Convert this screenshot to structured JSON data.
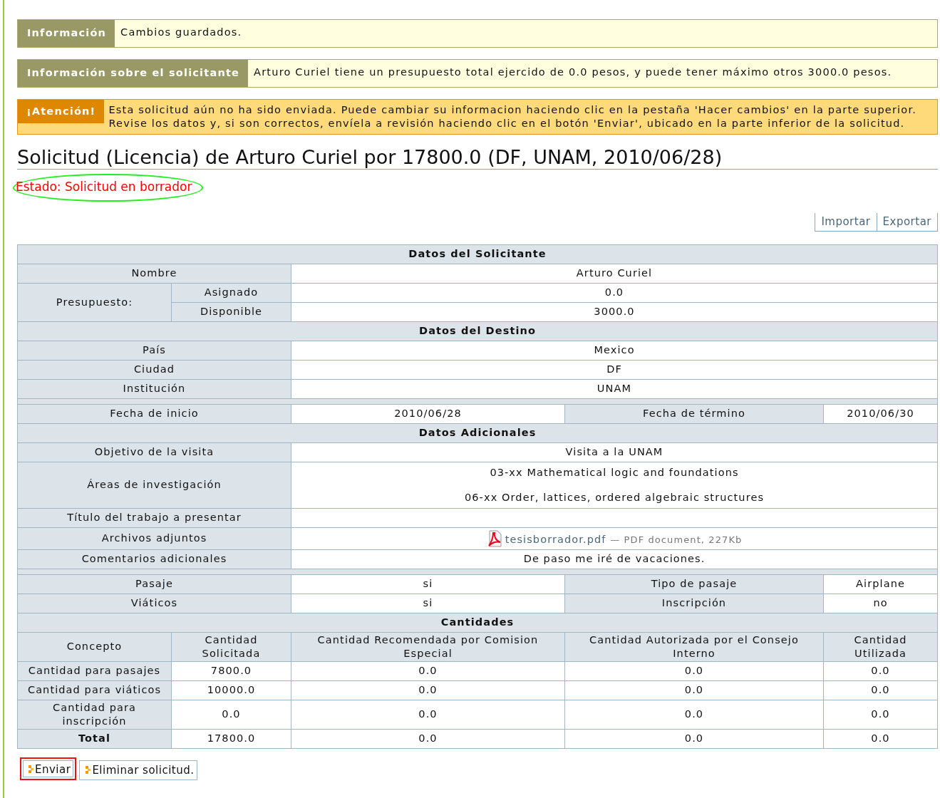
{
  "messages": [
    {
      "kind": "info",
      "label": "Información",
      "lines": [
        "Cambios guardados."
      ]
    },
    {
      "kind": "info",
      "label": "Información sobre el solicitante",
      "lines": [
        "Arturo Curiel tiene un presupuesto total ejercido de 0.0 pesos, y puede tener máximo otros 3000.0 pesos."
      ]
    },
    {
      "kind": "warning",
      "label": "¡Atención!",
      "lines": [
        "Esta solicitud aún no ha sido enviada. Puede cambiar su informacion haciendo clic en la pestaña 'Hacer cambios' en la parte superior.",
        "Revise los datos y, si son correctos, envíela a revisión haciendo clic en el botón 'Enviar', ubicado en la parte inferior de la solicitud."
      ]
    }
  ],
  "title": "Solicitud (Licencia) de Arturo Curiel por 17800.0 (DF, UNAM, 2010/06/28)",
  "status": {
    "text": "Estado: Solicitud en borrador",
    "highlighted": true
  },
  "actions": [
    "Importar",
    "Exportar"
  ],
  "applicant": {
    "heading": "Datos del Solicitante",
    "name_label": "Nombre",
    "name": "Arturo Curiel",
    "budget_label": "Presupuesto:",
    "budget": [
      {
        "label": "Asignado",
        "value": "0.0"
      },
      {
        "label": "Disponible",
        "value": "3000.0"
      }
    ]
  },
  "destination": {
    "heading": "Datos del Destino",
    "rows": [
      {
        "label": "País",
        "value": "Mexico"
      },
      {
        "label": "Ciudad",
        "value": "DF"
      },
      {
        "label": "Institución",
        "value": "UNAM"
      }
    ]
  },
  "dates": [
    {
      "label": "Fecha de inicio",
      "value": "2010/06/28"
    },
    {
      "label": "Fecha de término",
      "value": "2010/06/30"
    }
  ],
  "additional": {
    "heading": "Datos Adicionales",
    "rows": [
      {
        "kind": "text",
        "label": "Objetivo de la visita",
        "value": "Visita a la UNAM"
      },
      {
        "kind": "list",
        "label": "Áreas de investigación",
        "values": [
          "03-xx Mathematical logic and foundations",
          "06-xx Order, lattices, ordered algebraic structures"
        ]
      },
      {
        "kind": "text",
        "label": "Título del trabajo a presentar"
      },
      {
        "kind": "file",
        "label": "Archivos adjuntos",
        "file": "tesisborrador.pdf",
        "details": "— PDF document, 227Kb"
      },
      {
        "kind": "text",
        "label": "Comentarios adicionales",
        "value": "De paso me iré de vacaciones."
      }
    ]
  },
  "travel": [
    [
      {
        "label": "Pasaje",
        "value": "si"
      },
      {
        "label": "Tipo de pasaje",
        "value": "Airplane"
      }
    ],
    [
      {
        "label": "Viáticos",
        "value": "si"
      },
      {
        "label": "Inscripción",
        "value": "no"
      }
    ]
  ],
  "amounts": {
    "heading": "Cantidades",
    "columns": [
      "Concepto",
      "Cantidad Solicitada",
      "Cantidad Recomendada por Comision Especial",
      "Cantidad Autorizada por el Consejo Interno",
      "Cantidad Utilizada"
    ],
    "rows": [
      {
        "label": "Cantidad para pasajes",
        "values": [
          "7800.0",
          "0.0",
          "0.0",
          "0.0"
        ],
        "total": false
      },
      {
        "label": "Cantidad para viáticos",
        "values": [
          "10000.0",
          "0.0",
          "0.0",
          "0.0"
        ],
        "total": false
      },
      {
        "label": "Cantidad para inscripción",
        "values": [
          "0.0",
          "0.0",
          "0.0",
          "0.0"
        ],
        "total": false
      },
      {
        "label": "Total",
        "values": [
          "17800.0",
          "0.0",
          "0.0",
          "0.0"
        ],
        "total": true
      }
    ]
  },
  "buttons": [
    {
      "label": "Enviar",
      "highlighted": true
    },
    {
      "label": "Eliminar solicitud.",
      "highlighted": false
    }
  ]
}
